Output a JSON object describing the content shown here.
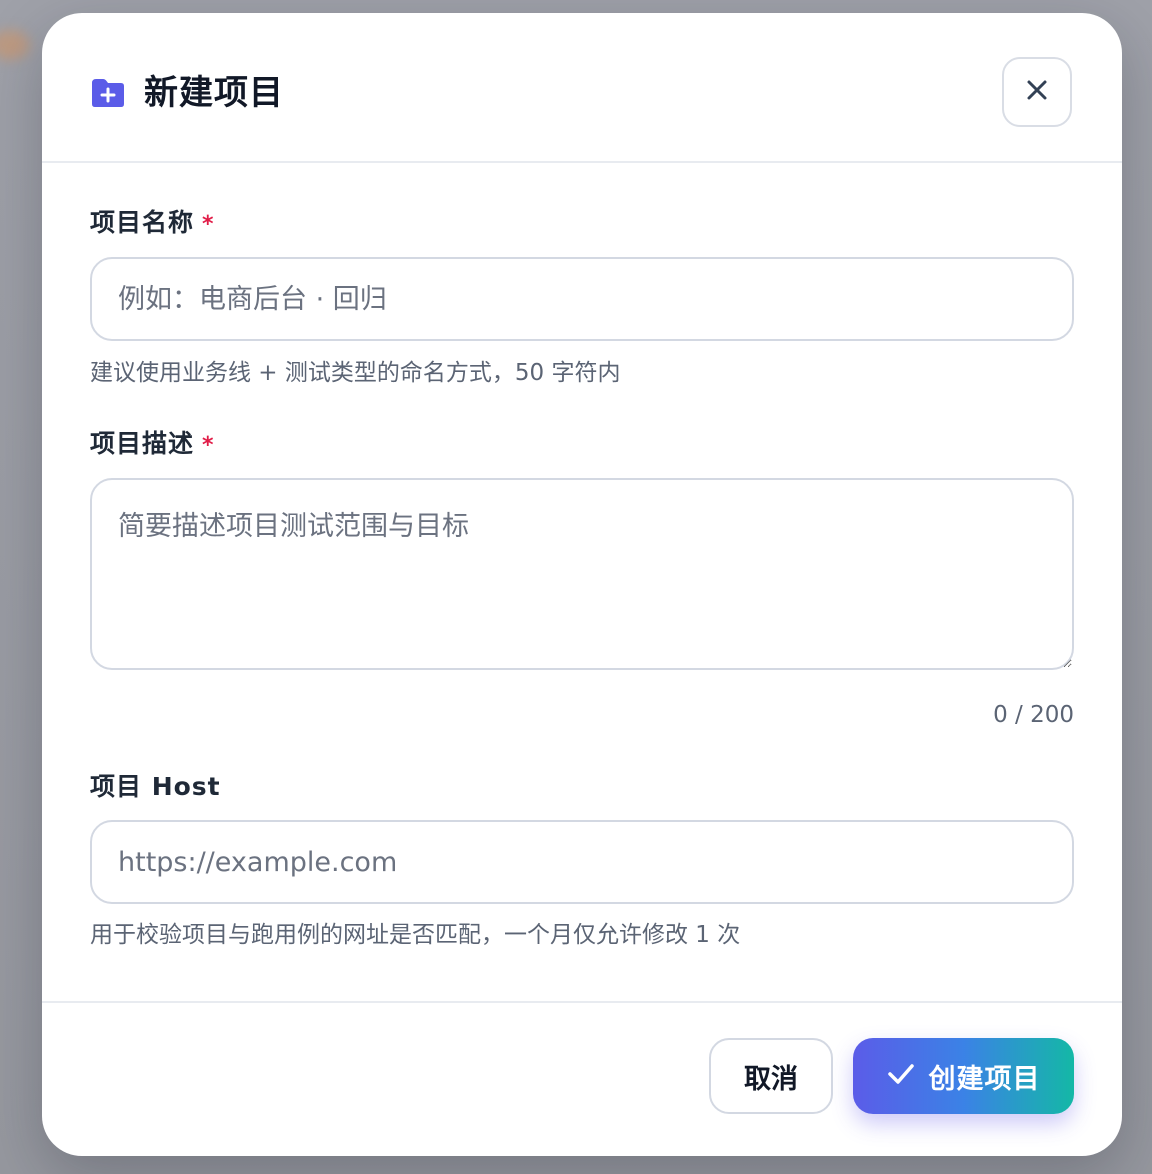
{
  "dialog": {
    "title": "新建项目",
    "icon": "folder-plus-icon",
    "accent_color": "#5b5ce8"
  },
  "fields": {
    "name": {
      "label": "项目名称",
      "required_mark": "*",
      "placeholder": "例如：电商后台 · 回归",
      "value": "",
      "helper": "建议使用业务线 + 测试类型的命名方式，50 字符内"
    },
    "description": {
      "label": "项目描述",
      "required_mark": "*",
      "placeholder": "简要描述项目测试范围与目标",
      "value": "",
      "counter": "0 / 200"
    },
    "host": {
      "label": "项目 Host",
      "placeholder": "https://example.com",
      "value": "",
      "helper": "用于校验项目与跑用例的网址是否匹配，一个月仅允许修改 1 次"
    }
  },
  "footer": {
    "cancel_label": "取消",
    "create_label": "创建项目",
    "create_gradient": [
      "#5b5ce8",
      "#3b82e6",
      "#14b8a6"
    ]
  }
}
